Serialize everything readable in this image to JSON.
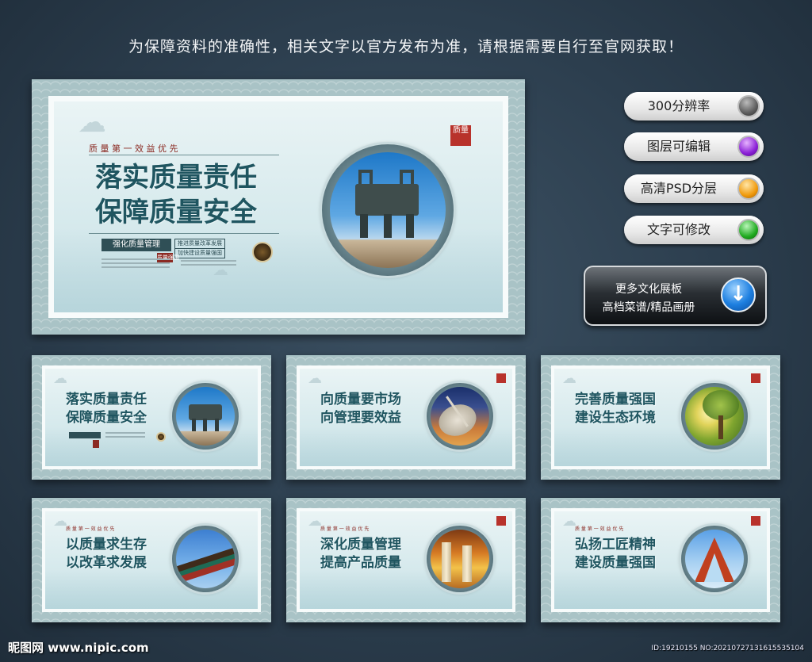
{
  "notice": "为保障资料的准确性，相关文字以官方发布为准，请根据需要自行至官网获取！",
  "main_board": {
    "subtitle": "质 量 第 一   效 益 优 先",
    "line1": "落实质量责任",
    "line2": "保障质量安全",
    "tag_dark": "强化质量管理",
    "tag_box_1": "推进质量改革发展",
    "tag_box_2": "加快建设质量强国",
    "tag_red": "质量强国",
    "seal_text": "质量"
  },
  "thumbs": [
    {
      "line1": "落实质量责任",
      "line2": "保障质量安全",
      "subtitle": "",
      "scene": "ding"
    },
    {
      "line1": "向质量要市场",
      "line2": "向管理要效益",
      "subtitle": "",
      "scene": "sundial"
    },
    {
      "line1": "完善质量强国",
      "line2": "建设生态环境",
      "subtitle": "",
      "scene": "tree"
    },
    {
      "line1": "以质量求生存",
      "line2": "以改革求发展",
      "subtitle": "质 量 第 一   效 益 优 先",
      "scene": "roof"
    },
    {
      "line1": "深化质量管理",
      "line2": "提高产品质量",
      "subtitle": "质 量 第 一   效 益 优 先",
      "scene": "pillar"
    },
    {
      "line1": "弘扬工匠精神",
      "line2": "建设质量强国",
      "subtitle": "质 量 第 一   效 益 优 先",
      "scene": "arch"
    }
  ],
  "features": [
    {
      "label": "300分辨率",
      "color": "#5d5d5d"
    },
    {
      "label": "图层可编辑",
      "color": "#8a1fd6"
    },
    {
      "label": "高清PSD分层",
      "color": "#f09a0c"
    },
    {
      "label": "文字可修改",
      "color": "#1faa1f"
    }
  ],
  "cta": {
    "line1": "更多文化展板",
    "line2": "高档菜谱/精品画册",
    "icon": "download-arrow-icon"
  },
  "watermark_left": "昵图网 www.nipic.com",
  "watermark_right": "ID:19210155 NO:20210727131615535104"
}
